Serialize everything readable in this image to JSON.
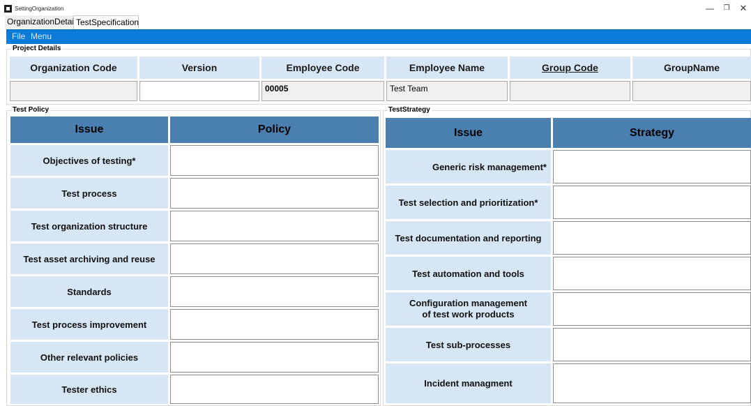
{
  "window": {
    "title": "SettingOrganization"
  },
  "tabs": [
    {
      "label": "OrganizationDetail"
    },
    {
      "label": "TestSpecification"
    }
  ],
  "menu": {
    "file": "File",
    "menu": "Menu"
  },
  "project_details": {
    "title": "Project Details",
    "headers": [
      "Organization Code",
      "Version",
      "Employee Code",
      "Employee Name",
      "Group Code",
      "GroupName"
    ],
    "values": [
      "",
      "",
      "00005",
      "Test Team",
      "",
      ""
    ]
  },
  "test_policy": {
    "title": "Test Policy",
    "col_issue": "Issue",
    "col_policy": "Policy",
    "rows": [
      "Objectives of testing*",
      "Test process",
      "Test organization structure",
      "Test asset archiving and reuse",
      "Standards",
      "Test process improvement",
      "Other relevant policies",
      "Tester ethics"
    ]
  },
  "test_strategy": {
    "title": "TestStrategy",
    "col_issue": "Issue",
    "col_strategy": "Strategy",
    "rows": [
      "Generic risk management*",
      "Test selection and prioritization*",
      "Test documentation and reporting",
      "Test automation and tools",
      "Configuration management\nof test work products",
      "Test sub-processes",
      "Incident managment"
    ]
  },
  "colors": {
    "menubar": "#0a7bd8",
    "header_cell": "#d6e6f4",
    "table_header": "#4a7fb0"
  }
}
